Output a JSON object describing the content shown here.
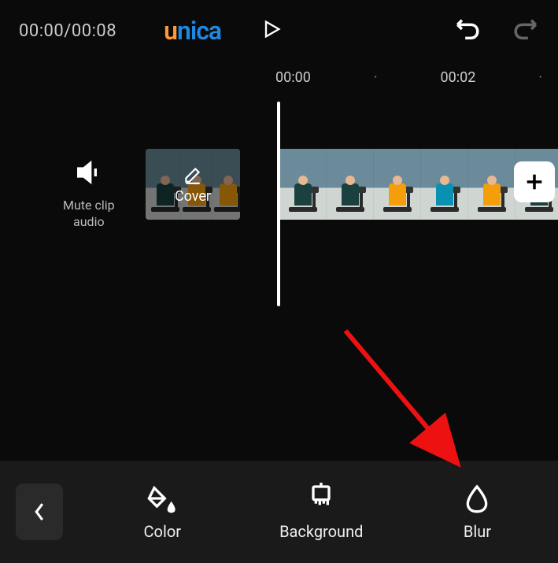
{
  "time": {
    "current": "00:00",
    "total": "00:08"
  },
  "logo": {
    "u": "u",
    "n": "n",
    "i": "i",
    "c": "c",
    "a": "a"
  },
  "ruler": {
    "t1": "00:00",
    "t2": "00:02"
  },
  "mute": {
    "label_l1": "Mute clip",
    "label_l2": "audio"
  },
  "cover": {
    "label": "Cover"
  },
  "tools": {
    "color": "Color",
    "background": "Background",
    "blur": "Blur"
  }
}
